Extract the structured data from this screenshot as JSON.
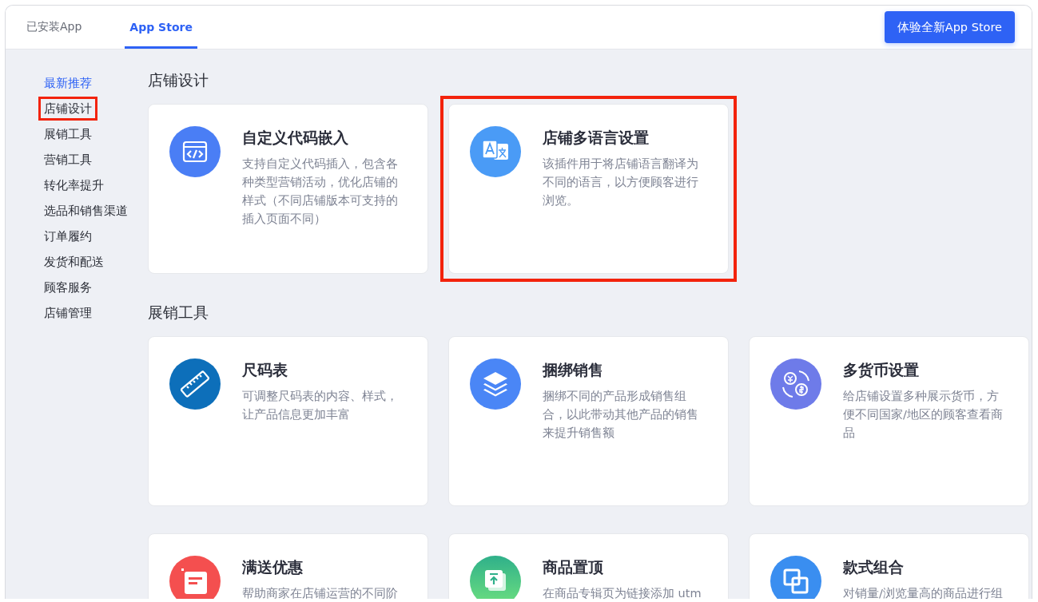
{
  "tabs": [
    {
      "label": "已安装App",
      "selected": false
    },
    {
      "label": "App Store",
      "selected": true
    }
  ],
  "header_button": "体验全新App Store",
  "sidebar": {
    "items": [
      {
        "label": "最新推荐",
        "selected": true,
        "highlighted": false
      },
      {
        "label": "店铺设计",
        "selected": false,
        "highlighted": true
      },
      {
        "label": "展销工具",
        "selected": false,
        "highlighted": false
      },
      {
        "label": "营销工具",
        "selected": false,
        "highlighted": false
      },
      {
        "label": "转化率提升",
        "selected": false,
        "highlighted": false
      },
      {
        "label": "选品和销售渠道",
        "selected": false,
        "highlighted": false
      },
      {
        "label": "订单履约",
        "selected": false,
        "highlighted": false
      },
      {
        "label": "发货和配送",
        "selected": false,
        "highlighted": false
      },
      {
        "label": "顾客服务",
        "selected": false,
        "highlighted": false
      },
      {
        "label": "店铺管理",
        "selected": false,
        "highlighted": false
      }
    ]
  },
  "sections": [
    {
      "title": "店铺设计",
      "apps": [
        {
          "kind": "code",
          "name": "自定义代码嵌入",
          "description": "支持自定义代码插入，包含各种类型营销活动，优化店铺的样式（不同店铺版本可支持的插入页面不同）",
          "highlighted": false
        },
        {
          "kind": "translate",
          "name": "店铺多语言设置",
          "description": "该插件用于将店铺语言翻译为不同的语言，以方便顾客进行浏览。",
          "highlighted": true
        }
      ]
    },
    {
      "title": "展销工具",
      "apps": [
        {
          "kind": "ruler",
          "name": "尺码表",
          "description": "可调整尺码表的内容、样式，让产品信息更加丰富",
          "highlighted": false
        },
        {
          "kind": "layers",
          "name": "捆绑销售",
          "description": "捆绑不同的产品形成销售组合，以此带动其他产品的销售来提升销售额",
          "highlighted": false
        },
        {
          "kind": "currency",
          "name": "多货币设置",
          "description": "给店铺设置多种展示货币，方便不同国家/地区的顾客查看商品",
          "highlighted": false
        },
        {
          "kind": "receipt",
          "name": "满送优惠",
          "description": "帮助商家在店铺运营的不同阶",
          "highlighted": false
        },
        {
          "kind": "pin",
          "name": "商品置顶",
          "description": "在商品专辑页为链接添加 utm",
          "highlighted": false
        },
        {
          "kind": "squares",
          "name": "款式组合",
          "description": "对销量/浏览量高的商品进行组",
          "highlighted": false
        }
      ]
    }
  ]
}
